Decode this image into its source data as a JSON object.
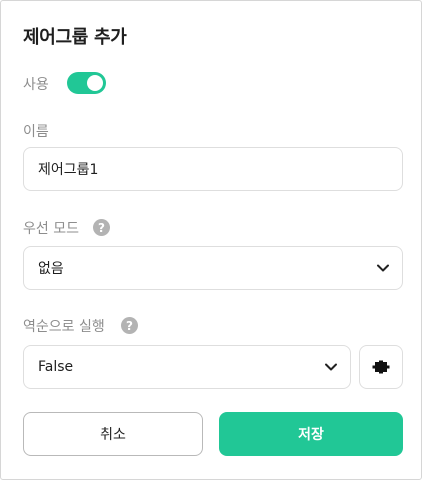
{
  "dialog": {
    "title": "제어그룹 추가",
    "use": {
      "label": "사용",
      "enabled": true
    },
    "name": {
      "label": "이름",
      "value": "제어그룹1"
    },
    "priority_mode": {
      "label": "우선 모드",
      "help": "?",
      "selected": "없음"
    },
    "reverse_exec": {
      "label": "역순으로 실행",
      "help": "?",
      "selected": "False"
    },
    "buttons": {
      "cancel": "취소",
      "save": "저장"
    },
    "icons": {
      "chevron": "chevron-down-icon",
      "puzzle": "puzzle-piece-icon",
      "help": "question-circle-icon"
    },
    "colors": {
      "accent": "#21c796",
      "label": "#8d8d8d",
      "border": "#dedede"
    }
  }
}
